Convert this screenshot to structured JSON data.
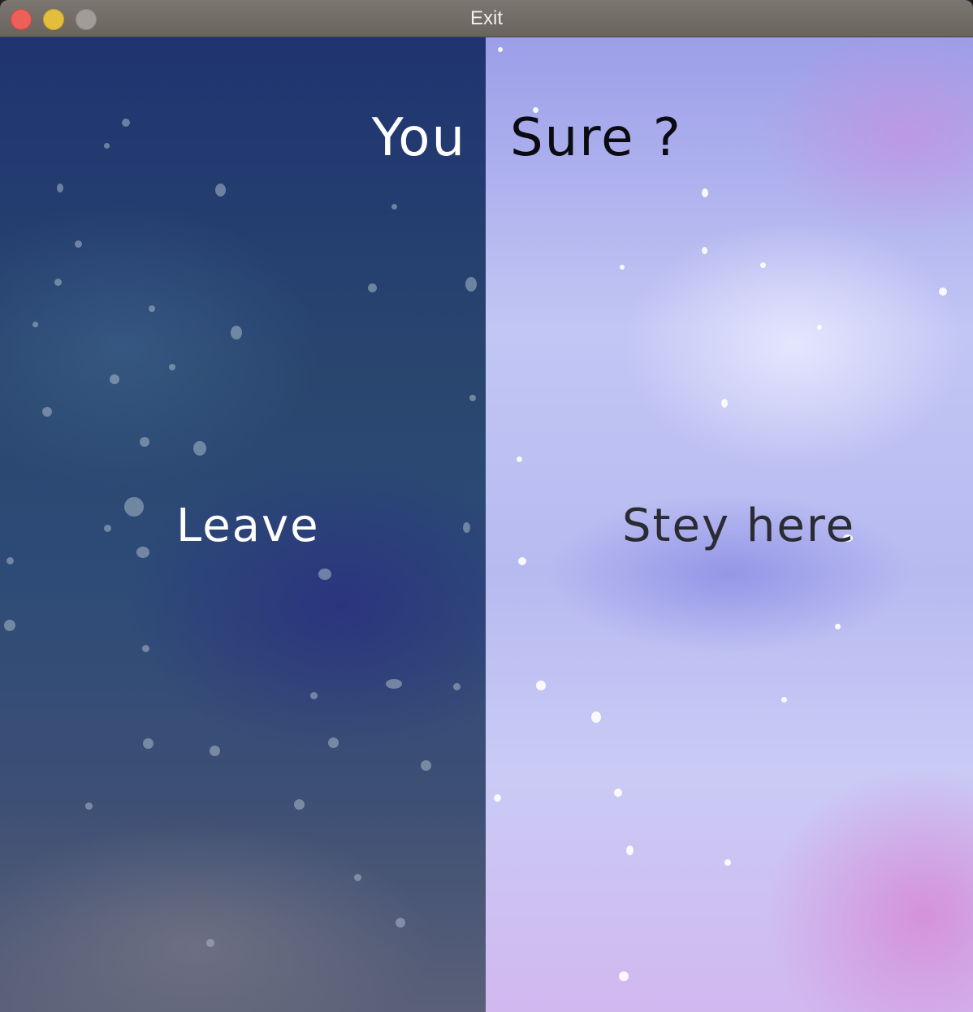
{
  "window": {
    "title": "Exit"
  },
  "prompt": {
    "left_text": "You",
    "right_text": "Sure ?"
  },
  "actions": {
    "leave_label": "Leave",
    "stay_label": "Stey here"
  },
  "colors": {
    "left_panel": "#29466f",
    "right_panel": "#b7baf0",
    "close": "#ee5f58",
    "minimize": "#e4bd3c",
    "zoom": "#a19c98"
  }
}
